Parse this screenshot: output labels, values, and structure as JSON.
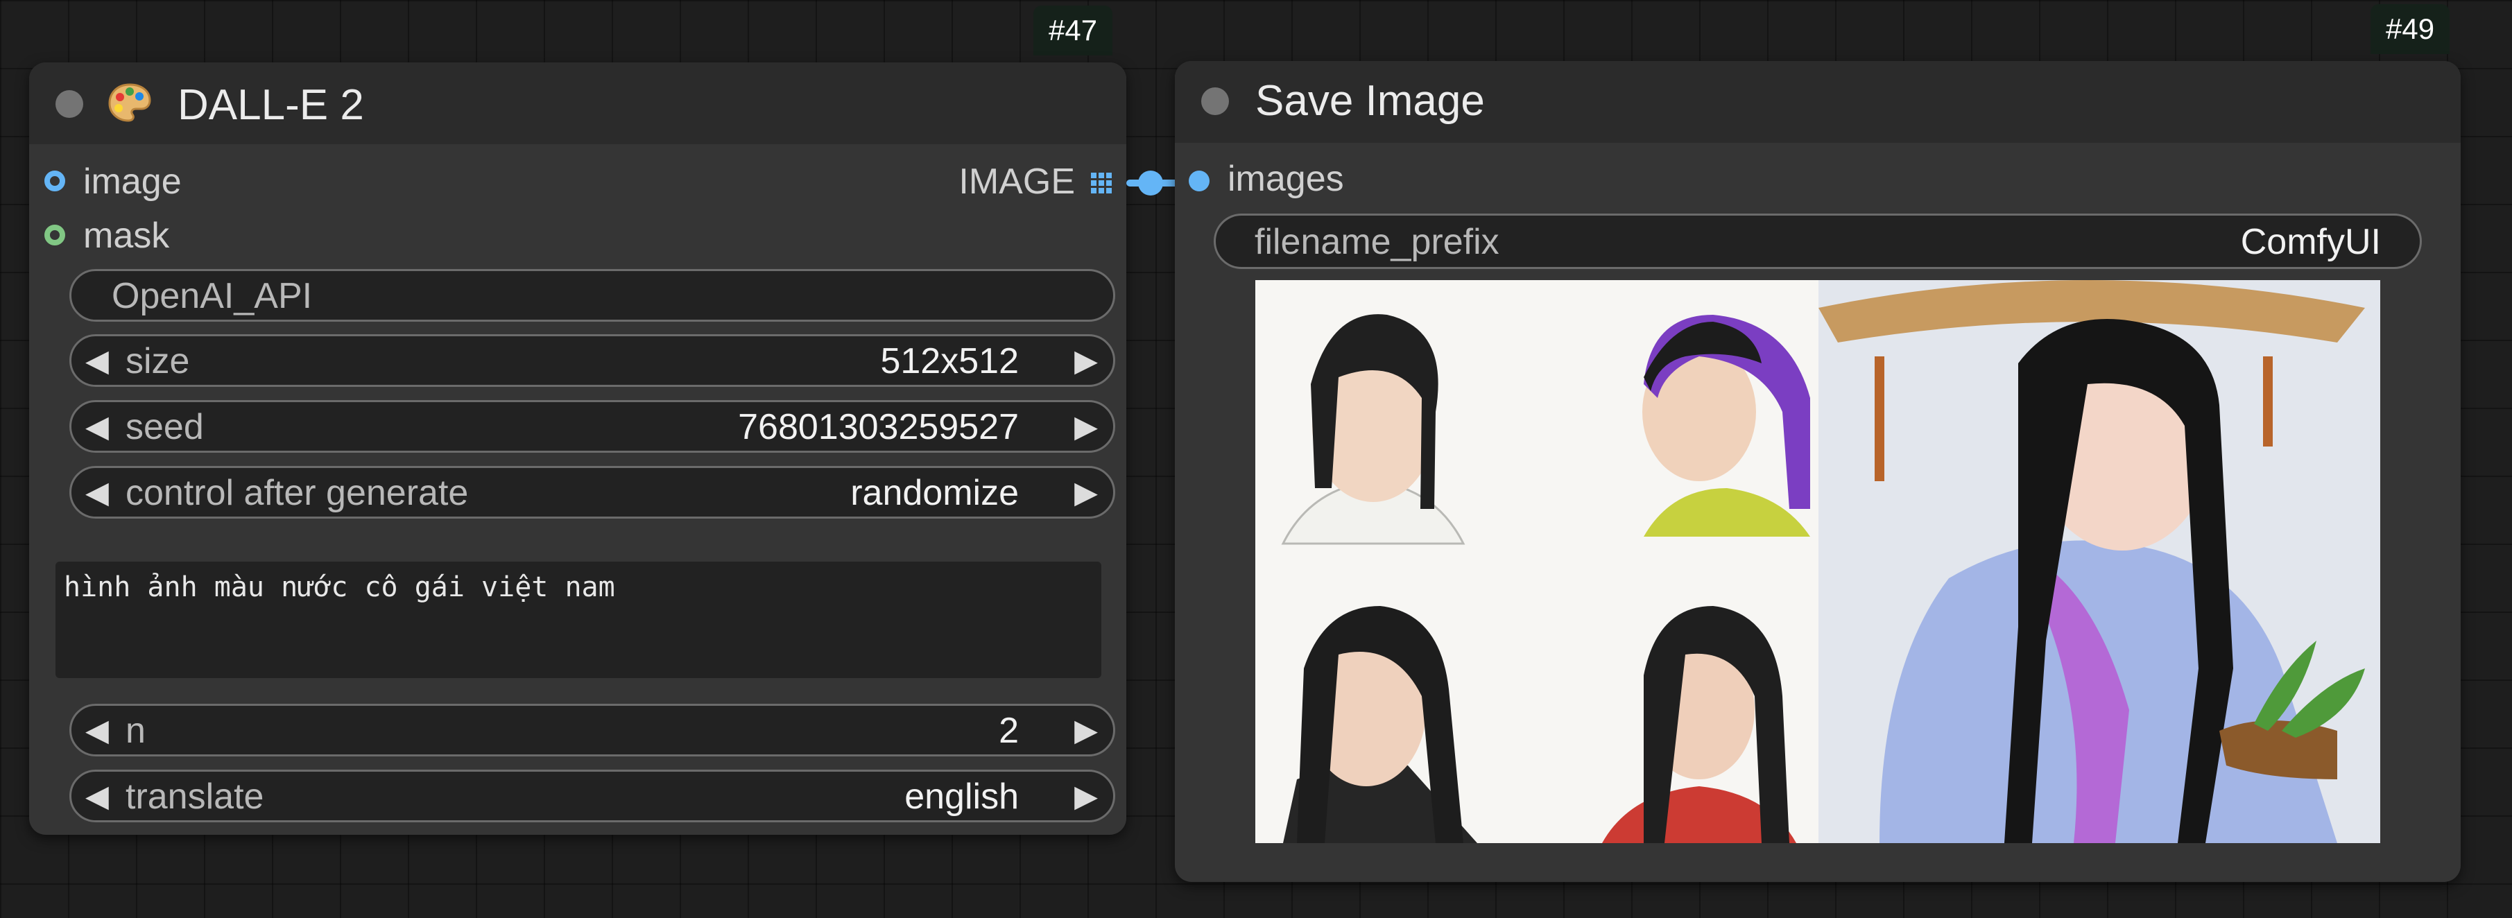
{
  "nodes": {
    "dalle": {
      "badge": "#47",
      "title": "DALL-E 2",
      "icon": "palette-icon",
      "inputs": [
        {
          "label": "image",
          "color": "#64b5f6"
        },
        {
          "label": "mask",
          "color": "#81c784"
        }
      ],
      "output": {
        "label": "IMAGE",
        "icon": "grid-icon"
      },
      "widgets": {
        "api": {
          "value": "OpenAI_API"
        },
        "size": {
          "label": "size",
          "value": "512x512"
        },
        "seed": {
          "label": "seed",
          "value": "76801303259527"
        },
        "control": {
          "label": "control after generate",
          "value": "randomize"
        },
        "n": {
          "label": "n",
          "value": "2"
        },
        "translate": {
          "label": "translate",
          "value": "english"
        }
      },
      "prompt": "hình ảnh màu nước cô gái việt nam"
    },
    "save": {
      "badge": "#49",
      "title": "Save Image",
      "input": {
        "label": "images",
        "color": "#64b5f6"
      },
      "filename_prefix": {
        "label": "filename_prefix",
        "value": "ComfyUI"
      },
      "preview": {
        "alt": "generated image preview",
        "images": 2
      }
    }
  },
  "colors": {
    "canvas": "#1e1e1e",
    "node_body": "#353535",
    "node_title": "#2b2b2b",
    "image_link": "#64b5f6",
    "mask_slot": "#81c784",
    "badge": "#15211a"
  }
}
